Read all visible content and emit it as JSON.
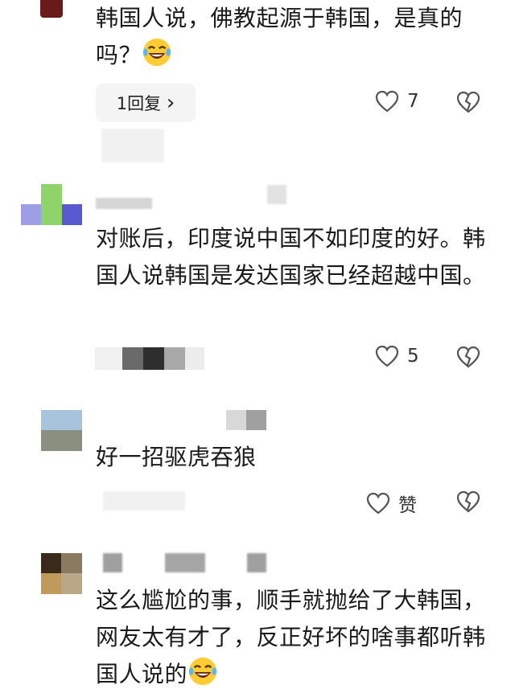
{
  "comments": [
    {
      "text": "韩国人说，佛教起源于韩国，是真的吗？",
      "emoji_icon": "laughing-tears-emoji-icon",
      "reply_label": "1回复",
      "reply_chevron": "›",
      "likes": "7"
    },
    {
      "text": "对账后，印度说中国不如印度的好。韩国人说韩国是发达国家已经超越中国。",
      "likes": "5"
    },
    {
      "text": "好一招驱虎吞狼",
      "likes": "赞"
    },
    {
      "text": "这么尴尬的事，顺手就抛给了大韩国，网友太有才了，反正好坏的啥事都听韩国人说的",
      "emoji_icon": "laughing-tears-emoji-icon"
    }
  ],
  "colors": {
    "text": "#1a1a1a",
    "icon": "#555555",
    "reply_bg": "#f4f4f4"
  }
}
